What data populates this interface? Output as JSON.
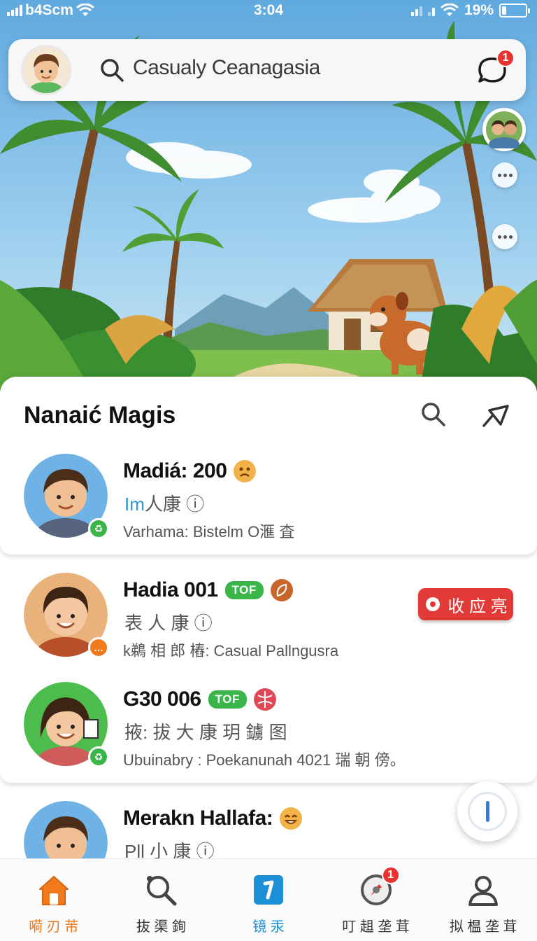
{
  "status_bar": {
    "carrier": "b4Scm",
    "time": "3:04",
    "battery": "19%",
    "battery_level": 0.19
  },
  "search": {
    "text": "Casualy Ceanagasia",
    "notification_count": "1"
  },
  "panel": {
    "title": "Nanaić Magis"
  },
  "list": [
    {
      "name": "Madiá: 200",
      "sub_highlight": "Im",
      "sub_rest": "人康 ⓘ",
      "desc": "Varhama: Bistelm O滙 査",
      "emoji": "sad-face",
      "status_color": "#39b54a"
    },
    {
      "name": "Hadia 001",
      "tag": "TOF",
      "sub": "表 人 康 ⓘ",
      "desc": "k鵜 相 郎 樁:  Casual Pallngusra",
      "action_label": "收 应 亮",
      "status_color": "#f07a1c"
    },
    {
      "name": "G30 006",
      "tag": "TOF",
      "sub": "掖: 拔 大 康 玥 鐪 图",
      "desc": "Ubuinabry : Poekanunah 4021 瑞 朝 傍。",
      "status_color": "#39b54a"
    },
    {
      "name": "Merakn Hallafa:",
      "sub": "Pll 小 康 ⓘ",
      "emoji": "grin-face"
    }
  ],
  "nav": [
    {
      "label": "嗬 刃 芾",
      "icon": "home-icon",
      "active": true
    },
    {
      "label": "抜 渠 銁",
      "icon": "search-icon"
    },
    {
      "label": "镜 汞",
      "icon": "task-icon"
    },
    {
      "label": "叮 趄 垄 茸",
      "icon": "compass-icon",
      "badge": "1"
    },
    {
      "label": "拟 榅 垄 茸",
      "icon": "profile-icon"
    }
  ],
  "colors": {
    "accent_orange": "#e8761e",
    "accent_blue": "#1c8fd6",
    "tag_green": "#39b54a",
    "action_red": "#e23b37",
    "badge_red": "#e8322f"
  }
}
